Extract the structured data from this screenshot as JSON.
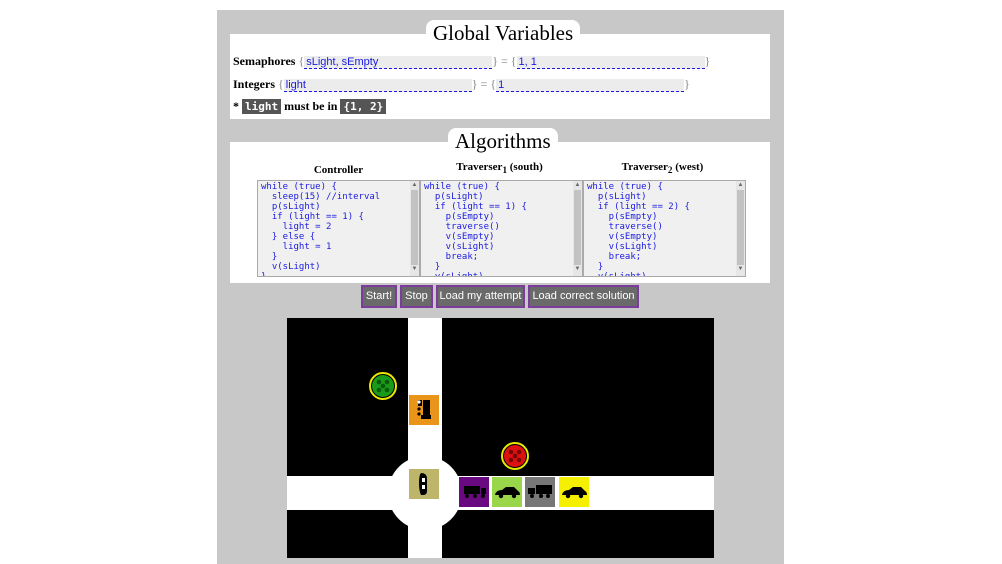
{
  "globals": {
    "title": "Global Variables",
    "semaphores_label": "Semaphores",
    "semaphore_names": "sLight, sEmpty",
    "semaphore_values": "1, 1",
    "integers_label": "Integers",
    "integer_names": "light",
    "integer_values": "1",
    "note_star": "*",
    "note_var": "light",
    "note_mid": "must be in",
    "note_set": "{1, 2}",
    "brace_open": "{",
    "brace_eq": "} = {",
    "brace_close": "}"
  },
  "algorithms": {
    "title": "Algorithms",
    "controller": {
      "title": "Controller",
      "code": "while (true) {\n  sleep(15) //interval\n  p(sLight)\n  if (light == 1) {\n    light = 2\n  } else {\n    light = 1\n  }\n  v(sLight)\n}"
    },
    "traverser1": {
      "title_prefix": "Traverser",
      "sub": "1",
      "title_suffix": " (south)",
      "code": "while (true) {\n  p(sLight)\n  if (light == 1) {\n    p(sEmpty)\n    traverse()\n    v(sEmpty)\n    v(sLight)\n    break;\n  }\n  v(sLight)\n}"
    },
    "traverser2": {
      "title_prefix": "Traverser",
      "sub": "2",
      "title_suffix": " (west)",
      "code": "while (true) {\n  p(sLight)\n  if (light == 2) {\n    p(sEmpty)\n    traverse()\n    v(sEmpty)\n    v(sLight)\n    break;\n  }\n  v(sLight)\n}"
    }
  },
  "buttons": {
    "start": "Start!",
    "stop": "Stop",
    "load_attempt": "Load my attempt",
    "load_solution": "Load correct solution"
  },
  "scene": {
    "light_north_color": "#22aa22",
    "light_east_color": "#dd1111",
    "vehicles": [
      {
        "name": "truck-orange",
        "color": "#e8951a"
      },
      {
        "name": "car-khaki",
        "color": "#bdb56a"
      },
      {
        "name": "truck-purple",
        "color": "#6a0a80"
      },
      {
        "name": "car-lime",
        "color": "#9ad64a"
      },
      {
        "name": "truck-gray",
        "color": "#777777"
      },
      {
        "name": "car-yellow",
        "color": "#f4f000"
      }
    ]
  }
}
